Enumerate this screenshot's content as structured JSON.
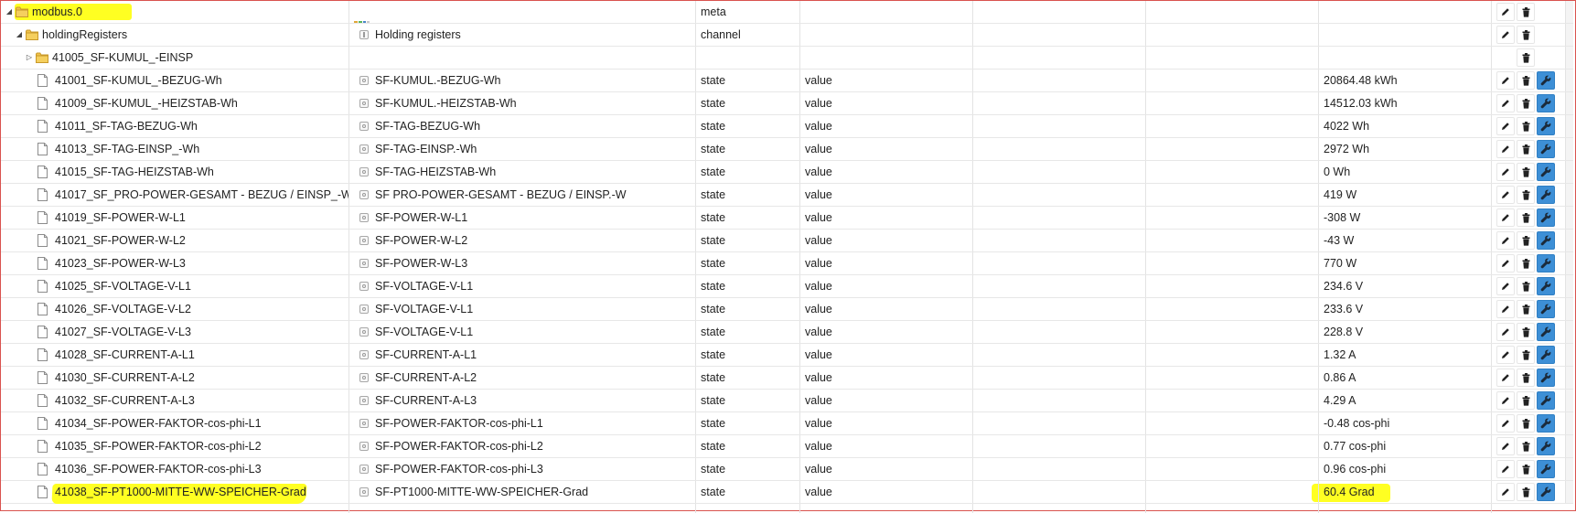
{
  "colors": {
    "highlight": "#ffff22",
    "customButton": "#3d8fd6",
    "border": "#d9534f",
    "folder": "#e8b733"
  },
  "rows": [
    {
      "kind": "folder",
      "tree": "expanded",
      "indent": 0,
      "id": "modbus.0",
      "name": "",
      "type": "meta",
      "role": "",
      "value": "",
      "actions": [
        "edit",
        "delete"
      ],
      "highlight": "top",
      "adapterIcon": true
    },
    {
      "kind": "folder",
      "tree": "expanded",
      "indent": 1,
      "id": "holdingRegisters",
      "name": "Holding registers",
      "nameIcon": "channel",
      "type": "channel",
      "role": "",
      "value": "",
      "actions": [
        "edit",
        "delete"
      ]
    },
    {
      "kind": "folder",
      "tree": "collapsed",
      "indent": 2,
      "id": "41005_SF-KUMUL_-EINSP",
      "name": "",
      "type": "",
      "role": "",
      "value": "",
      "actions": [
        "delete"
      ]
    },
    {
      "kind": "state",
      "indent": 2,
      "id": "41001_SF-KUMUL_-BEZUG-Wh",
      "name": "SF-KUMUL.-BEZUG-Wh",
      "type": "state",
      "role": "value",
      "value": "20864.48 kWh",
      "actions": [
        "edit",
        "delete",
        "custom"
      ]
    },
    {
      "kind": "state",
      "indent": 2,
      "id": "41009_SF-KUMUL_-HEIZSTAB-Wh",
      "name": "SF-KUMUL.-HEIZSTAB-Wh",
      "type": "state",
      "role": "value",
      "value": "14512.03 kWh",
      "actions": [
        "edit",
        "delete",
        "custom"
      ]
    },
    {
      "kind": "state",
      "indent": 2,
      "id": "41011_SF-TAG-BEZUG-Wh",
      "name": "SF-TAG-BEZUG-Wh",
      "type": "state",
      "role": "value",
      "value": "4022 Wh",
      "actions": [
        "edit",
        "delete",
        "custom"
      ]
    },
    {
      "kind": "state",
      "indent": 2,
      "id": "41013_SF-TAG-EINSP_-Wh",
      "name": "SF-TAG-EINSP.-Wh",
      "type": "state",
      "role": "value",
      "value": "2972 Wh",
      "actions": [
        "edit",
        "delete",
        "custom"
      ]
    },
    {
      "kind": "state",
      "indent": 2,
      "id": "41015_SF-TAG-HEIZSTAB-Wh",
      "name": "SF-TAG-HEIZSTAB-Wh",
      "type": "state",
      "role": "value",
      "value": "0 Wh",
      "actions": [
        "edit",
        "delete",
        "custom"
      ]
    },
    {
      "kind": "state",
      "indent": 2,
      "id": "41017_SF_PRO-POWER-GESAMT - BEZUG / EINSP_-W",
      "name": "SF PRO-POWER-GESAMT - BEZUG / EINSP.-W",
      "type": "state",
      "role": "value",
      "value": "419 W",
      "actions": [
        "edit",
        "delete",
        "custom"
      ]
    },
    {
      "kind": "state",
      "indent": 2,
      "id": "41019_SF-POWER-W-L1",
      "name": "SF-POWER-W-L1",
      "type": "state",
      "role": "value",
      "value": "-308 W",
      "actions": [
        "edit",
        "delete",
        "custom"
      ]
    },
    {
      "kind": "state",
      "indent": 2,
      "id": "41021_SF-POWER-W-L2",
      "name": "SF-POWER-W-L2",
      "type": "state",
      "role": "value",
      "value": "-43 W",
      "actions": [
        "edit",
        "delete",
        "custom"
      ]
    },
    {
      "kind": "state",
      "indent": 2,
      "id": "41023_SF-POWER-W-L3",
      "name": "SF-POWER-W-L3",
      "type": "state",
      "role": "value",
      "value": "770 W",
      "actions": [
        "edit",
        "delete",
        "custom"
      ]
    },
    {
      "kind": "state",
      "indent": 2,
      "id": "41025_SF-VOLTAGE-V-L1",
      "name": "SF-VOLTAGE-V-L1",
      "type": "state",
      "role": "value",
      "value": "234.6 V",
      "actions": [
        "edit",
        "delete",
        "custom"
      ]
    },
    {
      "kind": "state",
      "indent": 2,
      "id": "41026_SF-VOLTAGE-V-L2",
      "name": "SF-VOLTAGE-V-L1",
      "type": "state",
      "role": "value",
      "value": "233.6 V",
      "actions": [
        "edit",
        "delete",
        "custom"
      ]
    },
    {
      "kind": "state",
      "indent": 2,
      "id": "41027_SF-VOLTAGE-V-L3",
      "name": "SF-VOLTAGE-V-L1",
      "type": "state",
      "role": "value",
      "value": "228.8 V",
      "actions": [
        "edit",
        "delete",
        "custom"
      ]
    },
    {
      "kind": "state",
      "indent": 2,
      "id": "41028_SF-CURRENT-A-L1",
      "name": "SF-CURRENT-A-L1",
      "type": "state",
      "role": "value",
      "value": "1.32 A",
      "actions": [
        "edit",
        "delete",
        "custom"
      ]
    },
    {
      "kind": "state",
      "indent": 2,
      "id": "41030_SF-CURRENT-A-L2",
      "name": "SF-CURRENT-A-L2",
      "type": "state",
      "role": "value",
      "value": "0.86 A",
      "actions": [
        "edit",
        "delete",
        "custom"
      ]
    },
    {
      "kind": "state",
      "indent": 2,
      "id": "41032_SF-CURRENT-A-L3",
      "name": "SF-CURRENT-A-L3",
      "type": "state",
      "role": "value",
      "value": "4.29 A",
      "actions": [
        "edit",
        "delete",
        "custom"
      ]
    },
    {
      "kind": "state",
      "indent": 2,
      "id": "41034_SF-POWER-FAKTOR-cos-phi-L1",
      "name": "SF-POWER-FAKTOR-cos-phi-L1",
      "type": "state",
      "role": "value",
      "value": "-0.48 cos-phi",
      "actions": [
        "edit",
        "delete",
        "custom"
      ]
    },
    {
      "kind": "state",
      "indent": 2,
      "id": "41035_SF-POWER-FAKTOR-cos-phi-L2",
      "name": "SF-POWER-FAKTOR-cos-phi-L2",
      "type": "state",
      "role": "value",
      "value": "0.77 cos-phi",
      "actions": [
        "edit",
        "delete",
        "custom"
      ]
    },
    {
      "kind": "state",
      "indent": 2,
      "id": "41036_SF-POWER-FAKTOR-cos-phi-L3",
      "name": "SF-POWER-FAKTOR-cos-phi-L3",
      "type": "state",
      "role": "value",
      "value": "0.96 cos-phi",
      "actions": [
        "edit",
        "delete",
        "custom"
      ]
    },
    {
      "kind": "state",
      "indent": 2,
      "id": "41038_SF-PT1000-MITTE-WW-SPEICHER-Grad",
      "name": "SF-PT1000-MITTE-WW-SPEICHER-Grad",
      "type": "state",
      "role": "value",
      "value": "60.4 Grad",
      "actions": [
        "edit",
        "delete",
        "custom"
      ],
      "highlight": "both"
    }
  ]
}
